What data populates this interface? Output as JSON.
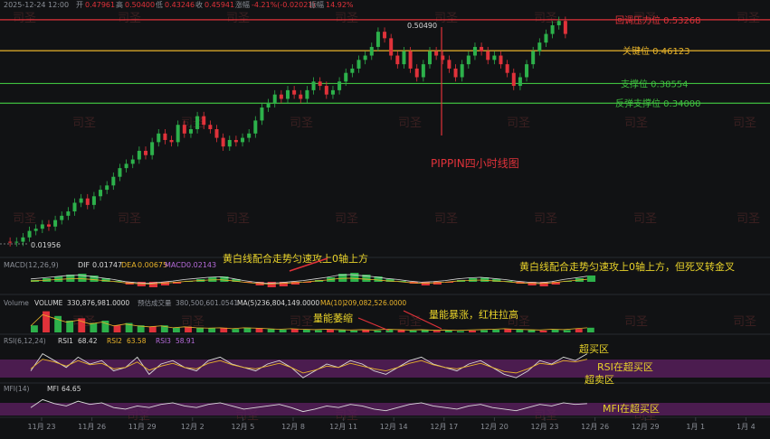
{
  "header": {
    "datetime": "2025-12-24 12:00",
    "open_label": "开",
    "open": "0.47961",
    "high_label": "高",
    "high": "0.50400",
    "low_label": "低",
    "low": "0.43246",
    "close_label": "收",
    "close": "0.45941",
    "change_label": "涨幅",
    "change": "-4.21%(-0.02021)",
    "amplitude_label": "振幅",
    "amplitude": "14.92%"
  },
  "watermark": "司圣",
  "chart_data": {
    "type": "candlestick",
    "title": "PIPPIN四小时线图",
    "x_ticks": [
      "11月 23",
      "11月 26",
      "11月 29",
      "12月 2",
      "12月 5",
      "12月 8",
      "12月 11",
      "12月 14",
      "12月 17",
      "12月 20",
      "12月 23",
      "12月 26",
      "12月 29",
      "1月 1",
      "1月 4"
    ],
    "price_markers": {
      "high": "0.50490",
      "low": "0.01956"
    },
    "levels": [
      {
        "label": "回调压力位 0.53268",
        "value": 0.53268,
        "color": "#e0323a"
      },
      {
        "label": "关键位 0.46123",
        "value": 0.46123,
        "color": "#e8b32a"
      },
      {
        "label": "支撑位 0.38554",
        "value": 0.38554,
        "color": "#3fbf3f"
      },
      {
        "label": "反弹支撑位 0.34000",
        "value": 0.34,
        "color": "#3fbf3f"
      }
    ],
    "price_path": [
      0.02,
      0.019,
      0.02,
      0.03,
      0.045,
      0.05,
      0.06,
      0.055,
      0.07,
      0.08,
      0.09,
      0.11,
      0.12,
      0.105,
      0.125,
      0.14,
      0.15,
      0.17,
      0.19,
      0.2,
      0.21,
      0.23,
      0.22,
      0.25,
      0.27,
      0.255,
      0.25,
      0.29,
      0.27,
      0.28,
      0.31,
      0.29,
      0.28,
      0.26,
      0.24,
      0.255,
      0.25,
      0.26,
      0.27,
      0.3,
      0.33,
      0.34,
      0.36,
      0.35,
      0.37,
      0.36,
      0.35,
      0.37,
      0.39,
      0.38,
      0.36,
      0.37,
      0.39,
      0.41,
      0.42,
      0.44,
      0.45,
      0.47,
      0.505,
      0.49,
      0.45,
      0.43,
      0.46,
      0.42,
      0.4,
      0.43,
      0.46,
      0.45,
      0.44,
      0.42,
      0.4,
      0.43,
      0.45,
      0.47,
      0.46,
      0.44,
      0.45,
      0.43,
      0.41,
      0.38,
      0.4,
      0.43,
      0.46,
      0.48,
      0.5,
      0.52,
      0.53,
      0.5
    ],
    "indicators": {
      "macd": {
        "name": "MACD(12,26,9)",
        "dif_label": "DIF",
        "dif": "0.01747",
        "dea_label": "DEA",
        "dea": "0.00675",
        "macd_label": "MACD",
        "macd": "0.02143",
        "hist": [
          0.2,
          0.4,
          0.6,
          0.8,
          0.9,
          0.7,
          0.4,
          0.1,
          -0.3,
          -0.5,
          -0.6,
          -0.4,
          -0.2,
          0.1,
          0.3,
          0.5,
          0.6,
          0.3,
          -0.1,
          -0.4,
          -0.6,
          -0.5,
          -0.3,
          -0.1,
          0.2,
          0.5,
          0.9,
          1.0,
          0.8,
          0.6,
          0.3,
          0.1,
          -0.2,
          -0.4,
          -0.3,
          -0.1,
          0.2,
          0.4,
          0.5,
          0.3,
          0.1,
          -0.2,
          -0.4,
          -0.5,
          -0.3,
          0.1,
          0.4,
          0.7
        ]
      },
      "volume": {
        "name": "Volume",
        "volume_label": "VOLUME",
        "volume": "330,876,981.0000",
        "turnover_label": "预估成交量",
        "turnover": "380,500,601.0541",
        "ma5_label": "MA(5)",
        "ma5": "236,804,149.0000",
        "ma10_label": "MA(10)",
        "ma10": "209,082,526.0000",
        "bars": [
          0.3,
          0.9,
          0.7,
          0.5,
          0.6,
          0.4,
          0.5,
          0.3,
          0.4,
          0.3,
          0.25,
          0.3,
          0.2,
          0.25,
          0.2,
          0.18,
          0.2,
          0.15,
          0.2,
          0.18,
          0.15,
          0.12,
          0.15,
          0.12,
          0.1,
          0.12,
          0.1,
          0.08,
          0.1,
          0.08,
          0.12,
          0.1,
          0.08,
          0.1,
          0.07,
          0.08,
          0.06,
          0.08,
          0.1,
          0.12,
          0.15,
          0.12,
          0.1,
          0.08,
          0.12,
          0.1,
          0.15,
          0.2
        ]
      },
      "rsi": {
        "name": "RSI(6,12,24)",
        "rsi1_label": "RSI1",
        "rsi1": "68.42",
        "rsi2_label": "RSI2",
        "rsi2": "63.58",
        "rsi3_label": "RSI3",
        "rsi3": "58.91",
        "rsi1_path": [
          55,
          80,
          70,
          60,
          75,
          65,
          70,
          55,
          60,
          75,
          50,
          65,
          70,
          60,
          55,
          70,
          75,
          65,
          60,
          55,
          65,
          70,
          60,
          45,
          55,
          65,
          60,
          70,
          65,
          55,
          50,
          60,
          70,
          75,
          65,
          60,
          55,
          65,
          70,
          60,
          50,
          45,
          55,
          70,
          65,
          75,
          70,
          80
        ],
        "rsi2_path": [
          58,
          72,
          68,
          62,
          70,
          64,
          66,
          58,
          60,
          68,
          56,
          62,
          66,
          60,
          58,
          66,
          70,
          64,
          60,
          58,
          62,
          66,
          60,
          52,
          56,
          62,
          60,
          66,
          62,
          58,
          55,
          60,
          66,
          70,
          64,
          60,
          58,
          62,
          66,
          60,
          54,
          52,
          58,
          66,
          64,
          70,
          68,
          72
        ]
      },
      "mfi": {
        "name": "MFI(14)",
        "mfi_label": "MFI",
        "mfi": "64.65",
        "path": [
          60,
          70,
          65,
          62,
          68,
          64,
          66,
          60,
          58,
          62,
          60,
          64,
          66,
          62,
          60,
          64,
          66,
          62,
          58,
          60,
          62,
          64,
          60,
          55,
          58,
          62,
          60,
          64,
          62,
          58,
          56,
          60,
          64,
          66,
          62,
          60,
          58,
          62,
          64,
          60,
          58,
          56,
          60,
          64,
          62,
          66,
          64,
          65
        ]
      }
    },
    "annotations": {
      "macd_left": "黄白线配合走势匀速攻上0轴上方",
      "macd_right": "黄白线配合走势匀速攻上0轴上方，但死叉转金叉",
      "vol_shrink": "量能萎缩",
      "vol_surge": "量能暴涨，红柱拉高",
      "rsi_overbought_top": "超买区",
      "rsi_in_overbought": "RSI在超买区",
      "rsi_oversold": "超卖区",
      "mfi_overbought": "MFI在超买区"
    }
  }
}
